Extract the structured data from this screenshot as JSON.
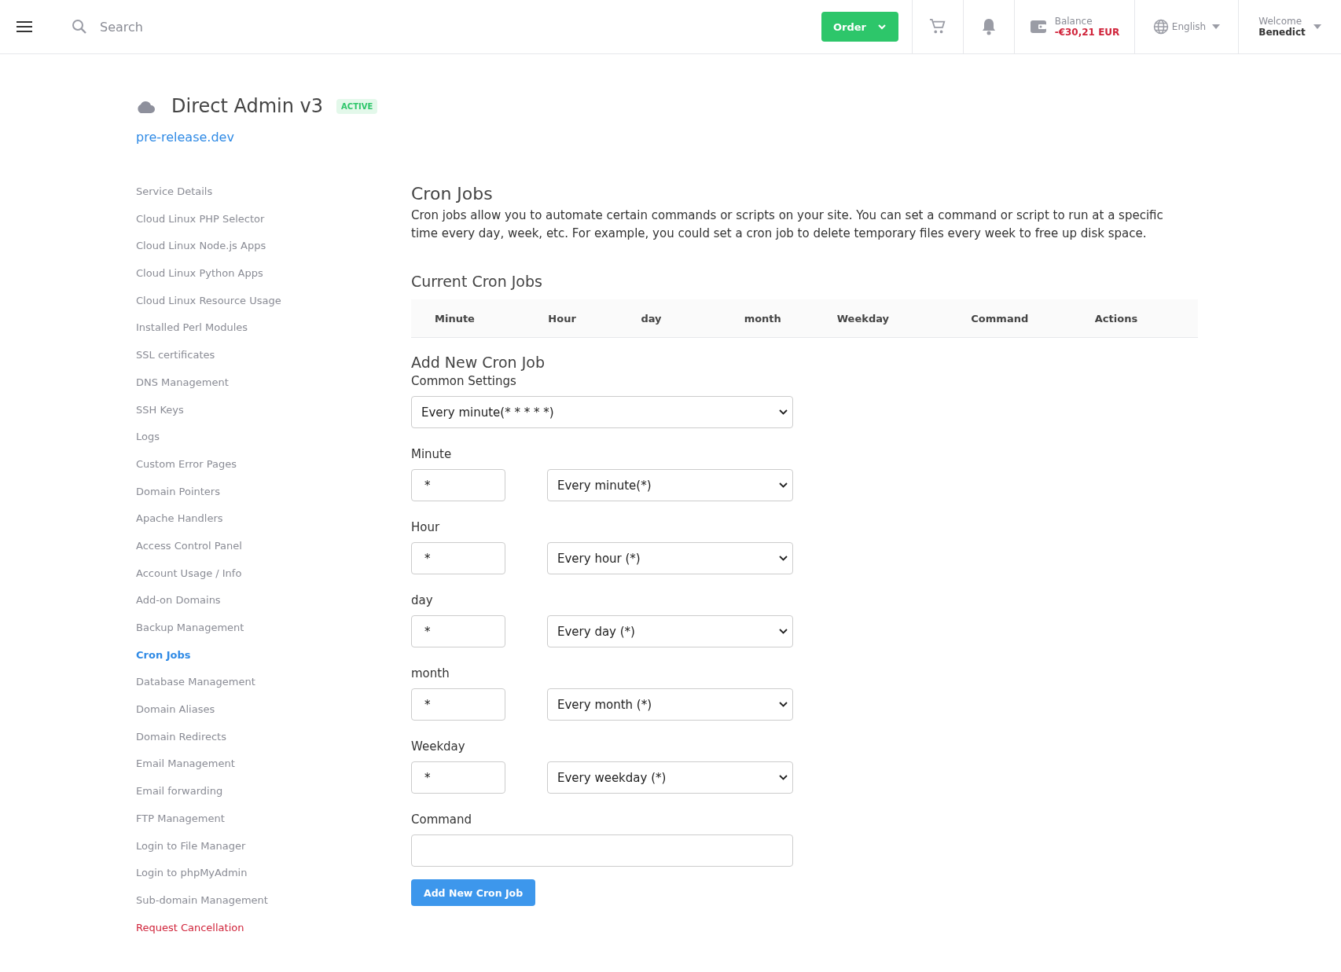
{
  "topbar": {
    "search": {
      "placeholder": "Search"
    },
    "order_button": "Order",
    "balance": {
      "label": "Balance",
      "amount": "-€30,21 EUR"
    },
    "language": "English",
    "user": {
      "greeting": "Welcome",
      "name": "Benedict"
    }
  },
  "service": {
    "title": "Direct Admin v3",
    "status": "ACTIVE",
    "domain": "pre-release.dev"
  },
  "sidebar": {
    "items": [
      {
        "label": "Service Details",
        "kind": "normal",
        "selected": false
      },
      {
        "label": "Cloud Linux PHP Selector",
        "kind": "normal",
        "selected": false
      },
      {
        "label": "Cloud Linux Node.js Apps",
        "kind": "normal",
        "selected": false
      },
      {
        "label": "Cloud Linux Python Apps",
        "kind": "normal",
        "selected": false
      },
      {
        "label": "Cloud Linux Resource Usage",
        "kind": "normal",
        "selected": false
      },
      {
        "label": "Installed Perl Modules",
        "kind": "normal",
        "selected": false
      },
      {
        "label": "SSL certificates",
        "kind": "normal",
        "selected": false
      },
      {
        "label": "DNS Management",
        "kind": "normal",
        "selected": false
      },
      {
        "label": "SSH Keys",
        "kind": "normal",
        "selected": false
      },
      {
        "label": "Logs",
        "kind": "normal",
        "selected": false
      },
      {
        "label": "Custom Error Pages",
        "kind": "normal",
        "selected": false
      },
      {
        "label": "Domain Pointers",
        "kind": "normal",
        "selected": false
      },
      {
        "label": "Apache Handlers",
        "kind": "normal",
        "selected": false
      },
      {
        "label": "Access Control Panel",
        "kind": "normal",
        "selected": false
      },
      {
        "label": "Account Usage / Info",
        "kind": "normal",
        "selected": false
      },
      {
        "label": "Add-on Domains",
        "kind": "normal",
        "selected": false
      },
      {
        "label": "Backup Management",
        "kind": "normal",
        "selected": false
      },
      {
        "label": "Cron Jobs",
        "kind": "normal",
        "selected": true
      },
      {
        "label": "Database Management",
        "kind": "normal",
        "selected": false
      },
      {
        "label": "Domain Aliases",
        "kind": "normal",
        "selected": false
      },
      {
        "label": "Domain Redirects",
        "kind": "normal",
        "selected": false
      },
      {
        "label": "Email Management",
        "kind": "normal",
        "selected": false
      },
      {
        "label": "Email forwarding",
        "kind": "normal",
        "selected": false
      },
      {
        "label": "FTP Management",
        "kind": "normal",
        "selected": false
      },
      {
        "label": "Login to File Manager",
        "kind": "normal",
        "selected": false
      },
      {
        "label": "Login to phpMyAdmin",
        "kind": "normal",
        "selected": false
      },
      {
        "label": "Sub-domain Management",
        "kind": "normal",
        "selected": false
      },
      {
        "label": "Request Cancellation",
        "kind": "danger",
        "selected": false
      }
    ]
  },
  "main": {
    "title": "Cron Jobs",
    "description": "Cron jobs allow you to automate certain commands or scripts on your site. You can set a command or script to run at a specific time every day, week, etc. For example, you could set a cron job to delete temporary files every week to free up disk space.",
    "current_title": "Current Cron Jobs",
    "table": {
      "columns": [
        "Minute",
        "Hour",
        "day",
        "month",
        "Weekday",
        "Command",
        "Actions"
      ]
    },
    "form": {
      "title": "Add New Cron Job",
      "common_label": "Common Settings",
      "common_value": "Every minute(* * * * *)",
      "fields": [
        {
          "label": "Minute",
          "value": "*",
          "preset": "Every minute(*)"
        },
        {
          "label": "Hour",
          "value": "*",
          "preset": "Every hour (*)"
        },
        {
          "label": "day",
          "value": "*",
          "preset": "Every day (*)"
        },
        {
          "label": "month",
          "value": "*",
          "preset": "Every month (*)"
        },
        {
          "label": "Weekday",
          "value": "*",
          "preset": "Every weekday (*)"
        }
      ],
      "command_label": "Command",
      "submit": "Add New Cron Job"
    }
  }
}
